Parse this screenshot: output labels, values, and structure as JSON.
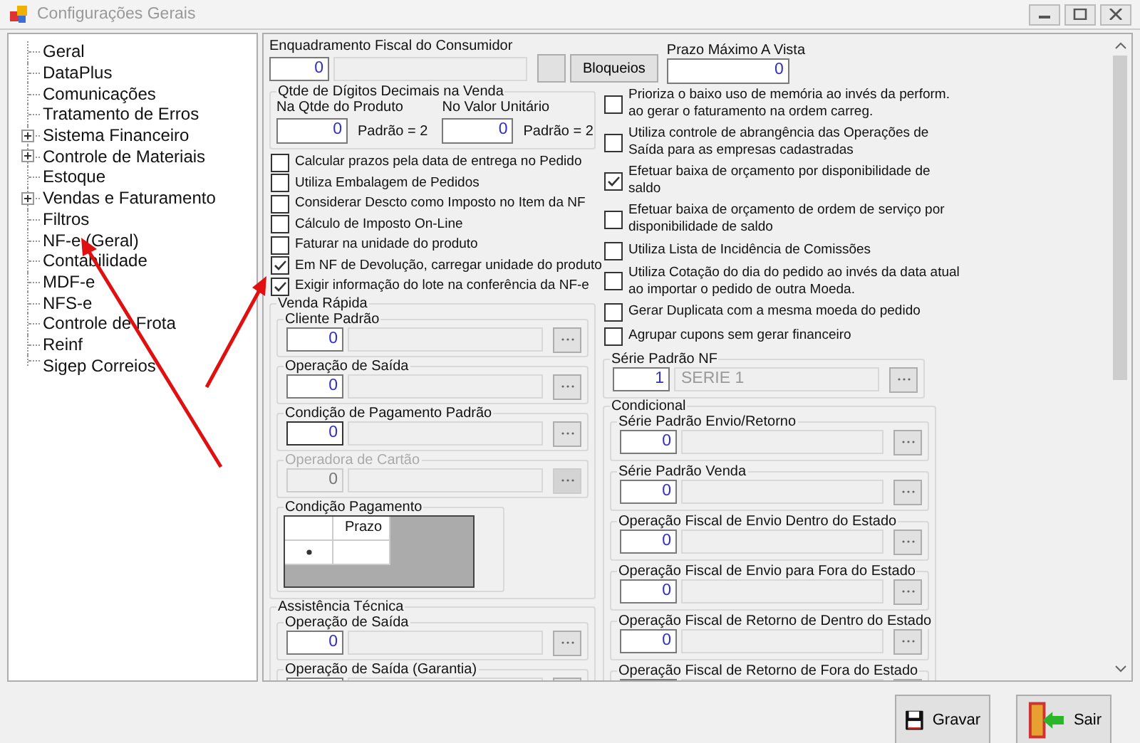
{
  "window": {
    "title": "Configurações Gerais"
  },
  "tree": {
    "items": [
      {
        "label": "Geral",
        "expandable": false
      },
      {
        "label": "DataPlus",
        "expandable": false
      },
      {
        "label": "Comunicações",
        "expandable": false
      },
      {
        "label": "Tratamento de Erros",
        "expandable": false
      },
      {
        "label": "Sistema Financeiro",
        "expandable": true
      },
      {
        "label": "Controle de Materiais",
        "expandable": true
      },
      {
        "label": "Estoque",
        "expandable": false
      },
      {
        "label": "Vendas e Faturamento",
        "expandable": true
      },
      {
        "label": "Filtros",
        "expandable": false
      },
      {
        "label": "NF-e (Geral)",
        "expandable": false
      },
      {
        "label": "Contabilidade",
        "expandable": false
      },
      {
        "label": "MDF-e",
        "expandable": false
      },
      {
        "label": "NFS-e",
        "expandable": false
      },
      {
        "label": "Controle de Frota",
        "expandable": false
      },
      {
        "label": "Reinf",
        "expandable": false
      },
      {
        "label": "Sigep Correios",
        "expandable": false
      }
    ]
  },
  "fiscal": {
    "label": "Enquadramento Fiscal do Consumidor",
    "code": "0",
    "button": "Bloqueios"
  },
  "prazo": {
    "label": "Prazo Máximo  A Vista",
    "value": "0"
  },
  "decimais": {
    "title": "Qtde de Dígitos Decimais na Venda",
    "fields": [
      {
        "label": "Na Qtde do Produto",
        "value": "0",
        "note": "Padrão = 2"
      },
      {
        "label": "No Valor Unitário",
        "value": "0",
        "note": "Padrão = 2"
      }
    ]
  },
  "left_options": [
    {
      "label": "Calcular prazos pela data de entrega no Pedido",
      "checked": false
    },
    {
      "label": "Utiliza Embalagem de Pedidos",
      "checked": false
    },
    {
      "label": "Considerar Descto como Imposto no Item da NF",
      "checked": false
    },
    {
      "label": "Cálculo de Imposto On-Line",
      "checked": false
    },
    {
      "label": "Faturar na unidade do produto",
      "checked": false
    },
    {
      "label": "Em NF de Devolução, carregar unidade do produto",
      "checked": true
    },
    {
      "label": "Exigir informação do lote na conferência da NF-e",
      "checked": true
    }
  ],
  "venda_rapida": {
    "title": "Venda Rápida",
    "lookups": [
      {
        "label": "Cliente Padrão",
        "code": "0",
        "disabled": false,
        "focused": false
      },
      {
        "label": "Operação de Saída",
        "code": "0",
        "disabled": false,
        "focused": false
      },
      {
        "label": "Condição de Pagamento Padrão",
        "code": "0",
        "disabled": false,
        "focused": true
      },
      {
        "label": "Operadora de Cartão",
        "code": "0",
        "disabled": true,
        "focused": false
      }
    ],
    "grid": {
      "title": "Condição Pagamento",
      "column": "Prazo"
    }
  },
  "assistencia": {
    "title": "Assistência Técnica",
    "lookups": [
      {
        "label": "Operação de Saída",
        "code": "0"
      },
      {
        "label": "Operação de Saída (Garantia)"
      }
    ]
  },
  "right_options": [
    {
      "label": "Prioriza o baixo uso de memória ao invés da perform. ao gerar o faturamento na ordem carreg.",
      "checked": false
    },
    {
      "label": "Utiliza controle de abrangência das Operações de Saída para as empresas cadastradas",
      "checked": false
    },
    {
      "label": "Efetuar baixa de orçamento por disponibilidade de saldo",
      "checked": true
    },
    {
      "label": "Efetuar baixa de orçamento de ordem de serviço por disponibilidade de saldo",
      "checked": false
    },
    {
      "label": "Utiliza Lista de Incidência de Comissões",
      "checked": false
    },
    {
      "label": "Utiliza Cotação do dia do pedido ao invés da data atual ao importar o pedido de outra Moeda.",
      "checked": false
    },
    {
      "label": "Gerar Duplicata com a mesma moeda do pedido",
      "checked": false
    },
    {
      "label": "Agrupar cupons sem gerar financeiro",
      "checked": false
    }
  ],
  "serie_nf": {
    "title": "Série Padrão NF",
    "code": "1",
    "description": "SERIE 1"
  },
  "condicional": {
    "title": "Condicional",
    "lookups": [
      {
        "label": "Série Padrão Envio/Retorno",
        "code": "0"
      },
      {
        "label": "Série Padrão Venda",
        "code": "0"
      },
      {
        "label": "Operação Fiscal de Envio Dentro do Estado",
        "code": "0"
      },
      {
        "label": "Operação Fiscal de Envio para Fora do Estado",
        "code": "0"
      },
      {
        "label": "Operação Fiscal de Retorno de Dentro do Estado",
        "code": "0"
      },
      {
        "label": "Operação Fiscal de Retorno de Fora do Estado"
      }
    ]
  },
  "buttons": [
    {
      "label": "Gravar",
      "kind": "save"
    },
    {
      "label": "Sair",
      "kind": "exit"
    }
  ]
}
